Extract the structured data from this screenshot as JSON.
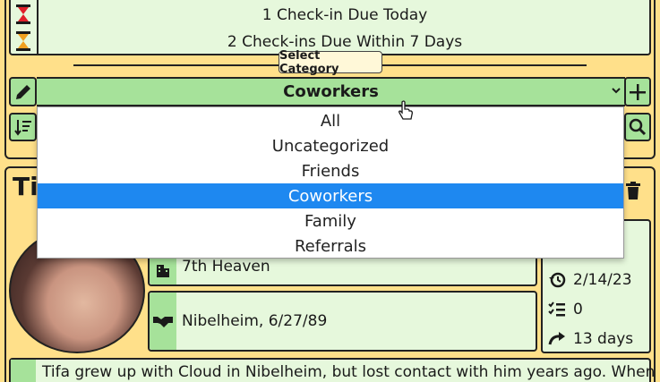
{
  "due": {
    "today": "1 Check-in Due Today",
    "week": "2 Check-ins Due Within 7 Days"
  },
  "category": {
    "section_label": "Select Category",
    "selected": "Coworkers",
    "add_label": "+",
    "options": [
      "All",
      "Uncategorized",
      "Friends",
      "Coworkers",
      "Family",
      "Referrals"
    ]
  },
  "contact": {
    "name_visible": "Ti",
    "company": "7th Heaven",
    "met": "Nibelheim, 6/27/89",
    "last_checkin": "2/14/23",
    "checkin_count": "0",
    "interval": "13 days",
    "bio": "Tifa grew up with Cloud in Nibelheim, but lost contact with him years ago. When"
  },
  "colors": {
    "background": "#ffe08a",
    "panel": "#e6f8dc",
    "accent_green": "#a6e29a",
    "selected_option": "#1e88f0",
    "hourglass_red": "#e0202a",
    "hourglass_orange": "#f0a020"
  },
  "icons": [
    "hourglass-red-icon",
    "hourglass-orange-icon",
    "pencil-icon",
    "chevron-down-icon",
    "plus-icon",
    "sort-icon",
    "search-icon",
    "trash-icon",
    "building-icon",
    "handshake-icon",
    "history-icon",
    "checklist-icon",
    "redo-arrow-icon",
    "mouse-pointer-icon"
  ]
}
